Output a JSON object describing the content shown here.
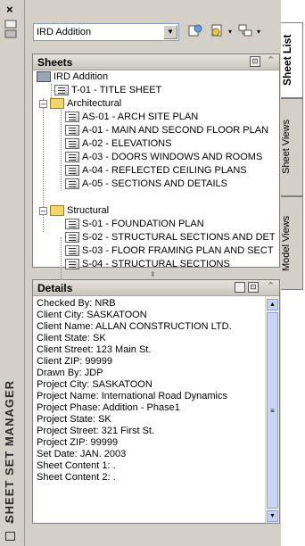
{
  "palette": {
    "title": "SHEET SET MANAGER",
    "close_glyph": "×"
  },
  "toolbar": {
    "sheetset_value": "IRD Addition",
    "icons": [
      "publish-icon",
      "sheet-list-icon",
      "model-views-icon"
    ]
  },
  "sheets_panel": {
    "title": "Sheets",
    "tree": [
      {
        "label": "IRD Addition",
        "level": 0,
        "kind": "root"
      },
      {
        "label": "T-01 - TITLE SHEET",
        "level": 1,
        "kind": "sheet"
      },
      {
        "label": "Architectural",
        "level": 1,
        "kind": "subset",
        "expanded": true
      },
      {
        "label": "AS-01 - ARCH SITE PLAN",
        "level": 2,
        "kind": "sheet"
      },
      {
        "label": "A-01 - MAIN AND SECOND FLOOR PLAN",
        "level": 2,
        "kind": "sheet"
      },
      {
        "label": "A-02 - ELEVATIONS",
        "level": 2,
        "kind": "sheet"
      },
      {
        "label": "A-03 - DOORS WINDOWS AND ROOMS",
        "level": 2,
        "kind": "sheet"
      },
      {
        "label": "A-04 - REFLECTED CEILING PLANS",
        "level": 2,
        "kind": "sheet"
      },
      {
        "label": "A-05 - SECTIONS AND DETAILS",
        "level": 2,
        "kind": "sheet"
      },
      {
        "label": "Structural",
        "level": 1,
        "kind": "subset",
        "expanded": true
      },
      {
        "label": "S-01 - FOUNDATION PLAN",
        "level": 2,
        "kind": "sheet"
      },
      {
        "label": "S-02 - STRUCTURAL SECTIONS AND DET",
        "level": 2,
        "kind": "sheet"
      },
      {
        "label": "S-03 - FLOOR FRAMING PLAN AND SECT",
        "level": 2,
        "kind": "sheet"
      },
      {
        "label": "S-04 - STRUCTURAL SECTIONS",
        "level": 2,
        "kind": "sheet"
      }
    ]
  },
  "details_panel": {
    "title": "Details",
    "lines": [
      "Checked By: NRB",
      "Client City: SASKATOON",
      "Client Name: ALLAN CONSTRUCTION LTD.",
      "Client State: SK",
      "Client Street: 123 Main St.",
      "Client ZIP: 99999",
      "Drawn By: JDP",
      "Project City: SASKATOON",
      "Project Name: International Road Dynamics",
      "Project Phase: Addition - Phase1",
      "Project State: SK",
      "Project Street: 321 First St.",
      "Project ZIP: 99999",
      "Set Date: JAN.  2003",
      "Sheet Content 1: .",
      "Sheet Content 2: ."
    ]
  },
  "tabs": [
    {
      "label": "Sheet List",
      "active": true
    },
    {
      "label": "Sheet Views",
      "active": false
    },
    {
      "label": "Model Views",
      "active": false
    }
  ],
  "colors": {
    "chrome": "#d4d0c8",
    "scroll_accent": "#c2d2f2"
  }
}
